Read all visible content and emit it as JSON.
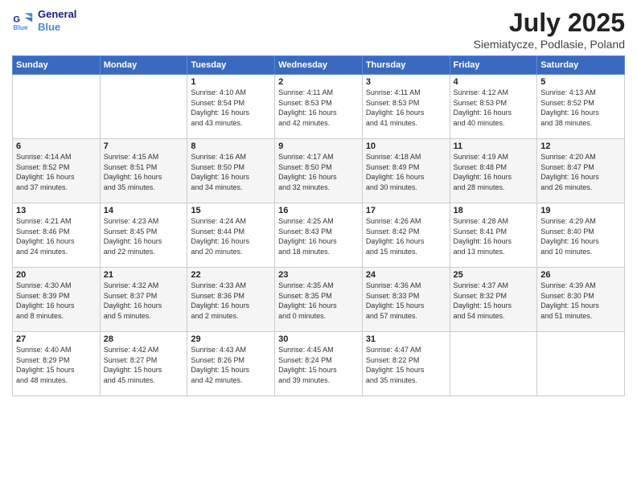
{
  "logo": {
    "line1": "General",
    "line2": "Blue"
  },
  "title": "July 2025",
  "subtitle": "Siemiatycze, Podlasie, Poland",
  "days_of_week": [
    "Sunday",
    "Monday",
    "Tuesday",
    "Wednesday",
    "Thursday",
    "Friday",
    "Saturday"
  ],
  "weeks": [
    [
      {
        "day": "",
        "info": ""
      },
      {
        "day": "",
        "info": ""
      },
      {
        "day": "1",
        "info": "Sunrise: 4:10 AM\nSunset: 8:54 PM\nDaylight: 16 hours\nand 43 minutes."
      },
      {
        "day": "2",
        "info": "Sunrise: 4:11 AM\nSunset: 8:53 PM\nDaylight: 16 hours\nand 42 minutes."
      },
      {
        "day": "3",
        "info": "Sunrise: 4:11 AM\nSunset: 8:53 PM\nDaylight: 16 hours\nand 41 minutes."
      },
      {
        "day": "4",
        "info": "Sunrise: 4:12 AM\nSunset: 8:53 PM\nDaylight: 16 hours\nand 40 minutes."
      },
      {
        "day": "5",
        "info": "Sunrise: 4:13 AM\nSunset: 8:52 PM\nDaylight: 16 hours\nand 38 minutes."
      }
    ],
    [
      {
        "day": "6",
        "info": "Sunrise: 4:14 AM\nSunset: 8:52 PM\nDaylight: 16 hours\nand 37 minutes."
      },
      {
        "day": "7",
        "info": "Sunrise: 4:15 AM\nSunset: 8:51 PM\nDaylight: 16 hours\nand 35 minutes."
      },
      {
        "day": "8",
        "info": "Sunrise: 4:16 AM\nSunset: 8:50 PM\nDaylight: 16 hours\nand 34 minutes."
      },
      {
        "day": "9",
        "info": "Sunrise: 4:17 AM\nSunset: 8:50 PM\nDaylight: 16 hours\nand 32 minutes."
      },
      {
        "day": "10",
        "info": "Sunrise: 4:18 AM\nSunset: 8:49 PM\nDaylight: 16 hours\nand 30 minutes."
      },
      {
        "day": "11",
        "info": "Sunrise: 4:19 AM\nSunset: 8:48 PM\nDaylight: 16 hours\nand 28 minutes."
      },
      {
        "day": "12",
        "info": "Sunrise: 4:20 AM\nSunset: 8:47 PM\nDaylight: 16 hours\nand 26 minutes."
      }
    ],
    [
      {
        "day": "13",
        "info": "Sunrise: 4:21 AM\nSunset: 8:46 PM\nDaylight: 16 hours\nand 24 minutes."
      },
      {
        "day": "14",
        "info": "Sunrise: 4:23 AM\nSunset: 8:45 PM\nDaylight: 16 hours\nand 22 minutes."
      },
      {
        "day": "15",
        "info": "Sunrise: 4:24 AM\nSunset: 8:44 PM\nDaylight: 16 hours\nand 20 minutes."
      },
      {
        "day": "16",
        "info": "Sunrise: 4:25 AM\nSunset: 8:43 PM\nDaylight: 16 hours\nand 18 minutes."
      },
      {
        "day": "17",
        "info": "Sunrise: 4:26 AM\nSunset: 8:42 PM\nDaylight: 16 hours\nand 15 minutes."
      },
      {
        "day": "18",
        "info": "Sunrise: 4:28 AM\nSunset: 8:41 PM\nDaylight: 16 hours\nand 13 minutes."
      },
      {
        "day": "19",
        "info": "Sunrise: 4:29 AM\nSunset: 8:40 PM\nDaylight: 16 hours\nand 10 minutes."
      }
    ],
    [
      {
        "day": "20",
        "info": "Sunrise: 4:30 AM\nSunset: 8:39 PM\nDaylight: 16 hours\nand 8 minutes."
      },
      {
        "day": "21",
        "info": "Sunrise: 4:32 AM\nSunset: 8:37 PM\nDaylight: 16 hours\nand 5 minutes."
      },
      {
        "day": "22",
        "info": "Sunrise: 4:33 AM\nSunset: 8:36 PM\nDaylight: 16 hours\nand 2 minutes."
      },
      {
        "day": "23",
        "info": "Sunrise: 4:35 AM\nSunset: 8:35 PM\nDaylight: 16 hours\nand 0 minutes."
      },
      {
        "day": "24",
        "info": "Sunrise: 4:36 AM\nSunset: 8:33 PM\nDaylight: 15 hours\nand 57 minutes."
      },
      {
        "day": "25",
        "info": "Sunrise: 4:37 AM\nSunset: 8:32 PM\nDaylight: 15 hours\nand 54 minutes."
      },
      {
        "day": "26",
        "info": "Sunrise: 4:39 AM\nSunset: 8:30 PM\nDaylight: 15 hours\nand 51 minutes."
      }
    ],
    [
      {
        "day": "27",
        "info": "Sunrise: 4:40 AM\nSunset: 8:29 PM\nDaylight: 15 hours\nand 48 minutes."
      },
      {
        "day": "28",
        "info": "Sunrise: 4:42 AM\nSunset: 8:27 PM\nDaylight: 15 hours\nand 45 minutes."
      },
      {
        "day": "29",
        "info": "Sunrise: 4:43 AM\nSunset: 8:26 PM\nDaylight: 15 hours\nand 42 minutes."
      },
      {
        "day": "30",
        "info": "Sunrise: 4:45 AM\nSunset: 8:24 PM\nDaylight: 15 hours\nand 39 minutes."
      },
      {
        "day": "31",
        "info": "Sunrise: 4:47 AM\nSunset: 8:22 PM\nDaylight: 15 hours\nand 35 minutes."
      },
      {
        "day": "",
        "info": ""
      },
      {
        "day": "",
        "info": ""
      }
    ]
  ]
}
